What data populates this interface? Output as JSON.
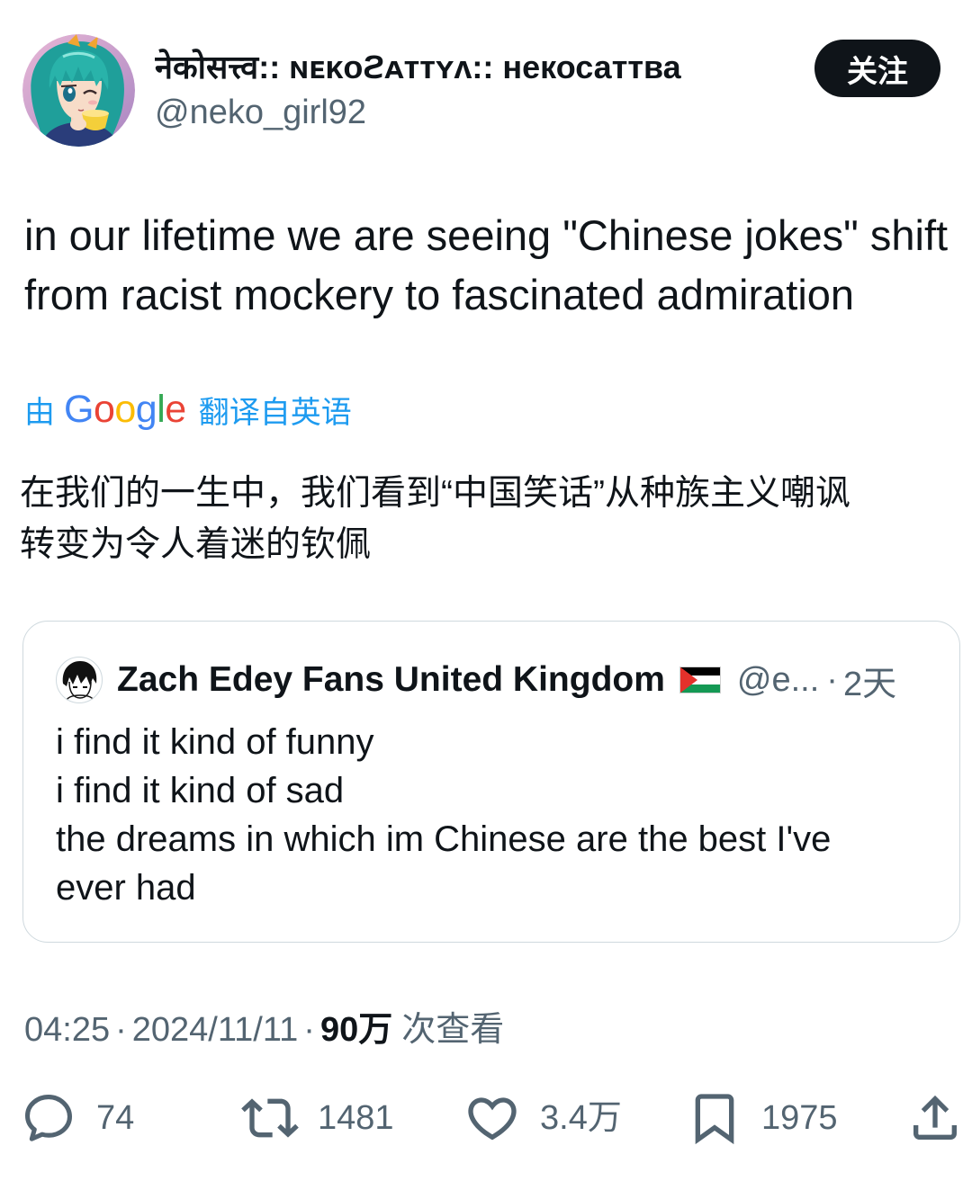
{
  "tweet": {
    "author": {
      "display_name": "नेकोसत्त्व:: ɴᴇᴋᴏϩᴀᴛᴛʏᴧ:: некосаттва",
      "handle": "@neko_girl92",
      "avatar_icon": "anime-avatar-icon"
    },
    "follow_label": "关注",
    "text": "in our lifetime we are seeing \"Chinese jokes\" shift from racist mockery to fascinated admiration",
    "translation": {
      "prefix": "由",
      "brand": "Google",
      "brand_colors": [
        "#4285f4",
        "#ea4335",
        "#fbbc05",
        "#4285f4",
        "#34a853",
        "#ea4335"
      ],
      "suffix": "翻译自英语",
      "text": "在我们的一生中，我们看到“中国笑话”从种族主义嘲讽\n转变为令人着迷的钦佩"
    },
    "quote": {
      "avatar_icon": "anime-avatar-icon",
      "author_name": "Zach Edey Fans United Kingdom",
      "flag_icon": "palestine-flag-icon",
      "handle": "@e...",
      "separator": "·",
      "time": "2天",
      "text": "i find it kind of funny\ni find it kind of sad\nthe dreams in which im Chinese are the best I've ever had"
    },
    "meta": {
      "time": "04:25",
      "separator": "·",
      "date": "2024/11/11",
      "views_count": "90万",
      "views_label": "次查看"
    },
    "actions": {
      "reply": {
        "icon": "reply-icon",
        "count": "74"
      },
      "retweet": {
        "icon": "retweet-icon",
        "count": "1481"
      },
      "like": {
        "icon": "heart-icon",
        "count": "3.4万"
      },
      "bookmark": {
        "icon": "bookmark-icon",
        "count": "1975"
      },
      "share": {
        "icon": "share-icon"
      }
    }
  },
  "colors": {
    "text_primary": "#0f1419",
    "text_secondary": "#536471",
    "accent": "#1d9bf0",
    "button_bg": "#0f1419",
    "button_text": "#ffffff",
    "border": "#cfd9de"
  }
}
